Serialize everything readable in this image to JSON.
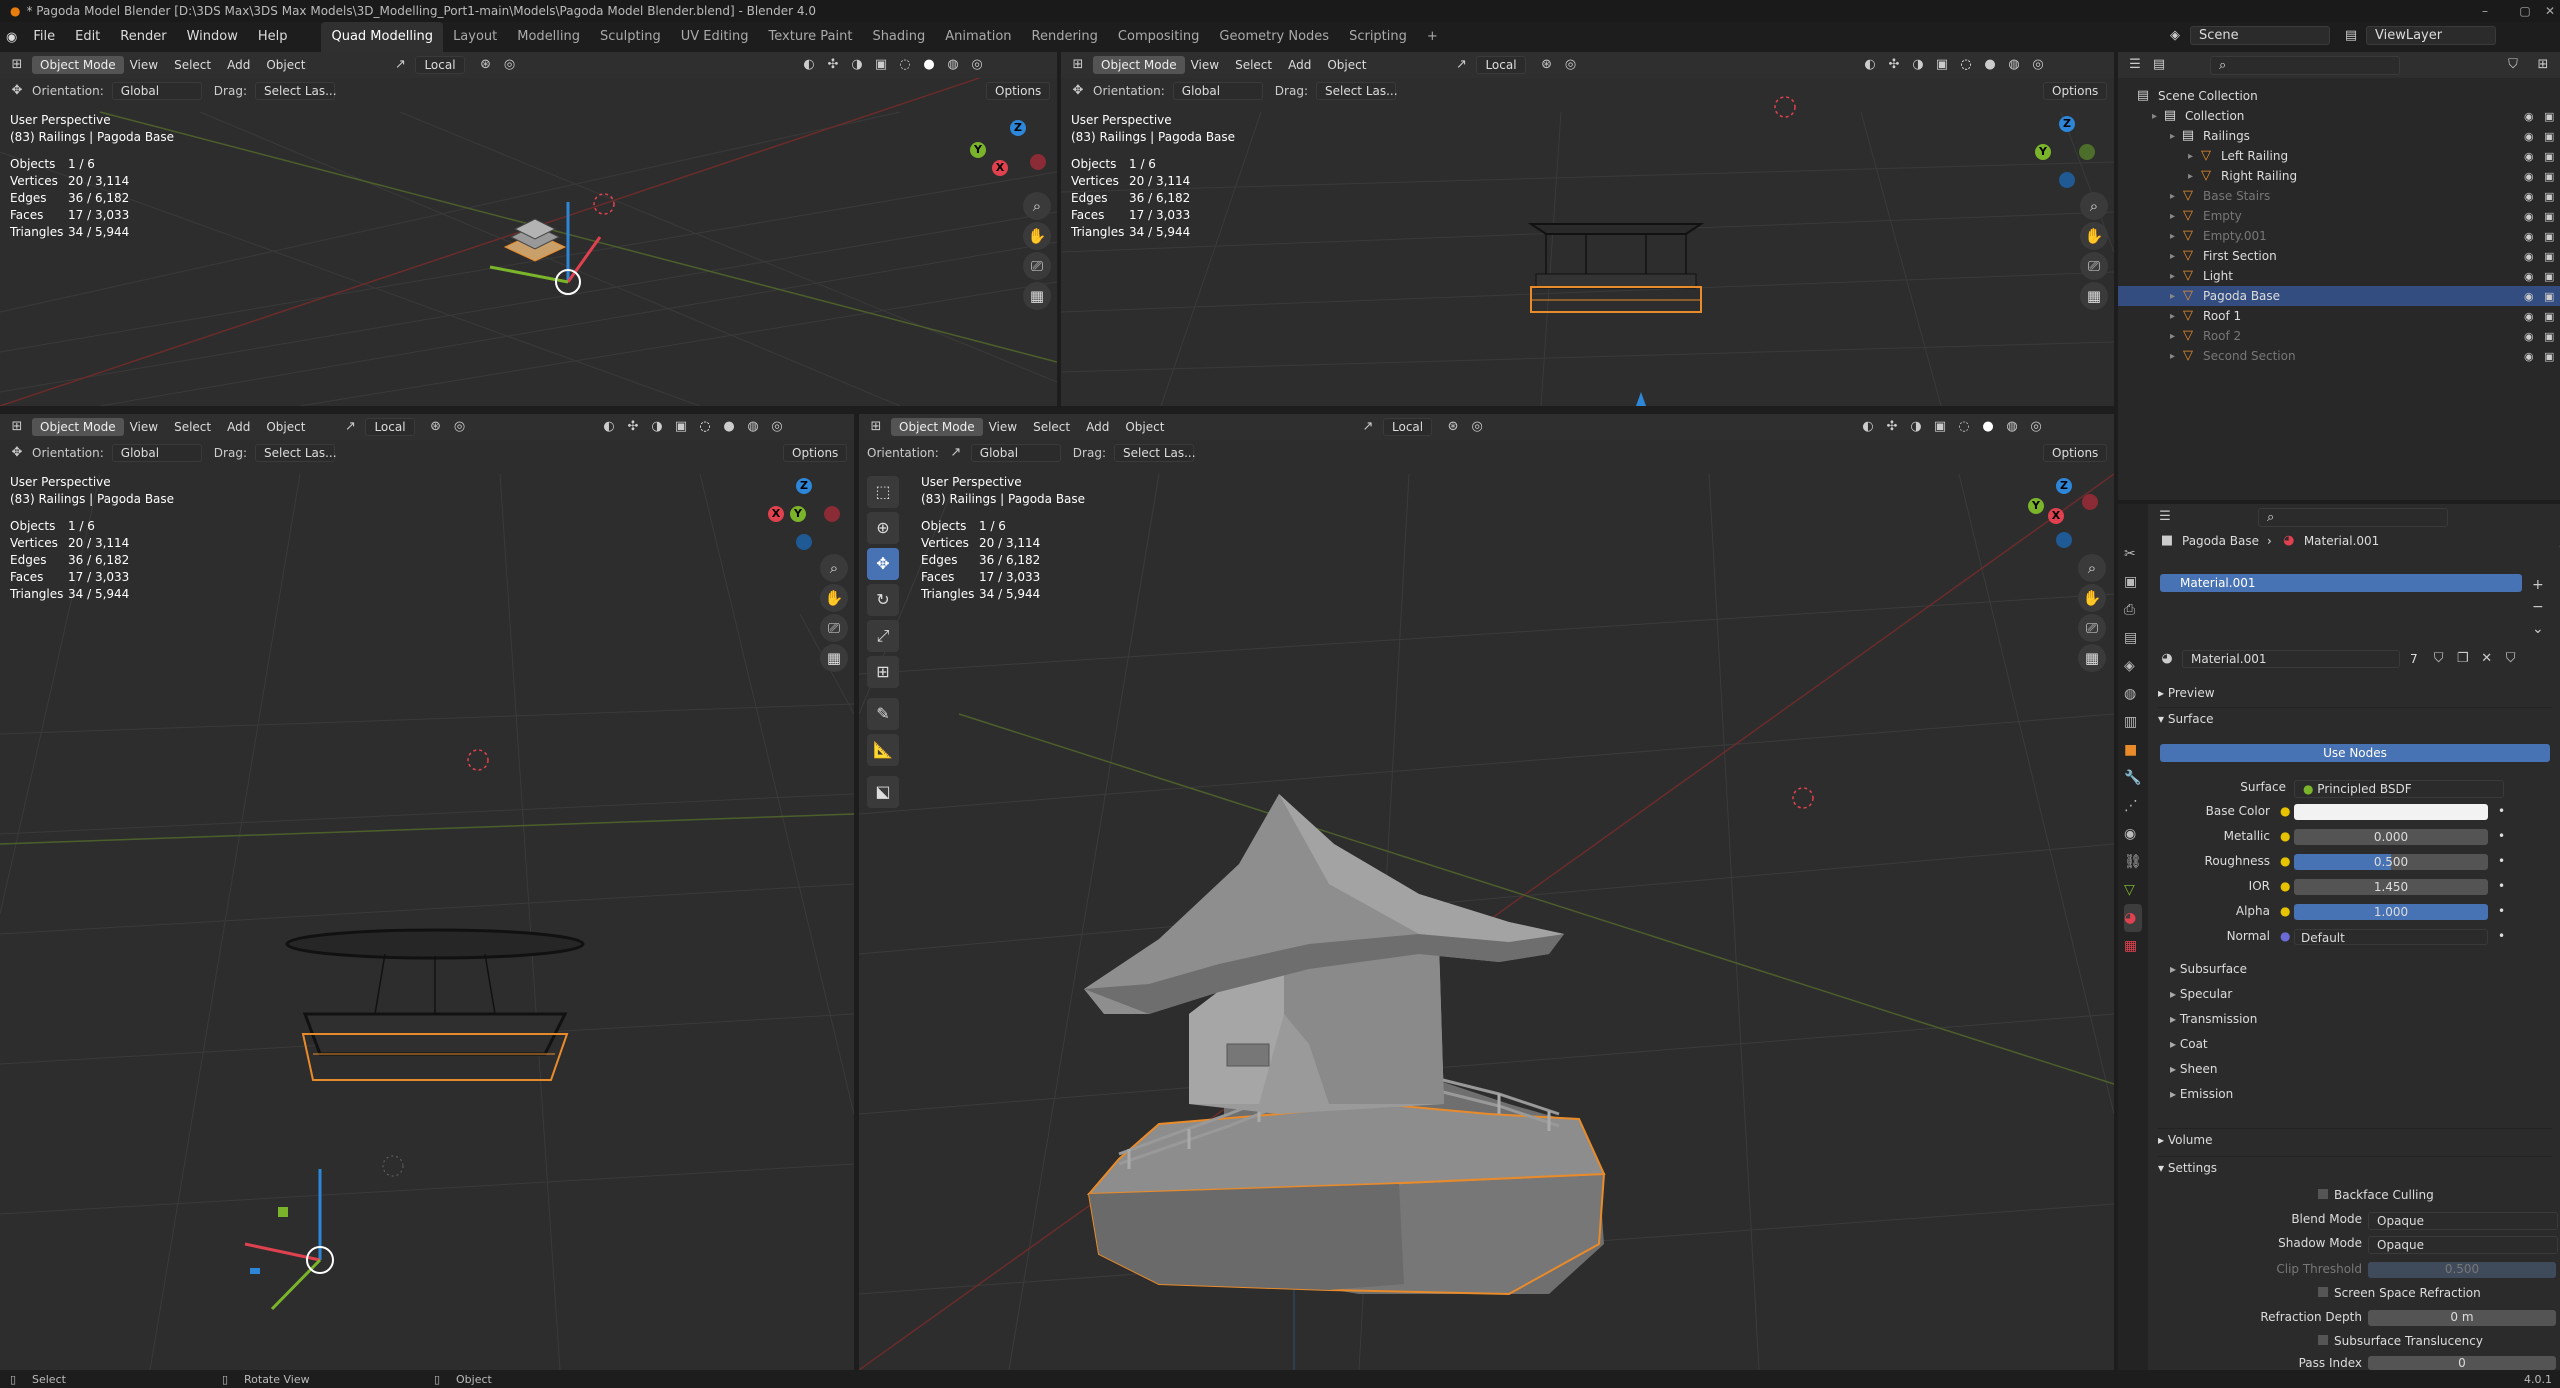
{
  "window": {
    "title": "* Pagoda Model Blender [D:\\3DS Max\\3DS Max Models\\3D_Modelling_Port1-main\\Models\\Pagoda Model Blender.blend] - Blender 4.0"
  },
  "menu": [
    "File",
    "Edit",
    "Render",
    "Window",
    "Help"
  ],
  "workspaces": [
    "Quad Modelling",
    "Layout",
    "Modelling",
    "Sculpting",
    "UV Editing",
    "Texture Paint",
    "Shading",
    "Animation",
    "Rendering",
    "Compositing",
    "Geometry Nodes",
    "Scripting",
    "+"
  ],
  "scene": {
    "name": "Scene",
    "view_layer": "ViewLayer"
  },
  "viewport": {
    "mode": "Object Mode",
    "view": "View",
    "select": "Select",
    "add": "Add",
    "object": "Object",
    "transform": "Local",
    "orientation_label": "Orientation:",
    "orientation": "Global",
    "drag_label": "Drag:",
    "drag": "Select Las...",
    "options": "Options",
    "perspective": "User Perspective",
    "context": "(83) Railings | Pagoda Base",
    "stats": [
      {
        "k": "Objects",
        "v": "1 / 6"
      },
      {
        "k": "Vertices",
        "v": "20 / 3,114"
      },
      {
        "k": "Edges",
        "v": "36 / 6,182"
      },
      {
        "k": "Faces",
        "v": "17 / 3,033"
      },
      {
        "k": "Triangles",
        "v": "34 / 5,944"
      }
    ],
    "axes": {
      "x": "X",
      "y": "Y",
      "z": "Z"
    }
  },
  "outliner": {
    "root": "Scene Collection",
    "items": [
      {
        "name": "Collection",
        "level": 1,
        "dim": false
      },
      {
        "name": "Railings",
        "level": 2,
        "dim": false
      },
      {
        "name": "Left Railing",
        "level": 3,
        "dim": false
      },
      {
        "name": "Right Railing",
        "level": 3,
        "dim": false
      },
      {
        "name": "Base Stairs",
        "level": 2,
        "dim": true
      },
      {
        "name": "Empty",
        "level": 2,
        "dim": true
      },
      {
        "name": "Empty.001",
        "level": 2,
        "dim": true
      },
      {
        "name": "First Section",
        "level": 2,
        "dim": false
      },
      {
        "name": "Light",
        "level": 2,
        "dim": false
      },
      {
        "name": "Pagoda Base",
        "level": 2,
        "dim": false,
        "selected": true
      },
      {
        "name": "Roof 1",
        "level": 2,
        "dim": false
      },
      {
        "name": "Roof 2",
        "level": 2,
        "dim": true
      },
      {
        "name": "Second Section",
        "level": 2,
        "dim": true
      }
    ]
  },
  "properties": {
    "breadcrumb_object": "Pagoda Base",
    "breadcrumb_material": "Material.001",
    "slot": "Material.001",
    "material": "Material.001",
    "users": "7",
    "panels": {
      "preview": "Preview",
      "surface": "Surface",
      "use_nodes": "Use Nodes"
    },
    "surface_label": "Surface",
    "surface_value": "Principled BSDF",
    "fields": [
      {
        "label": "Base Color",
        "value": "",
        "kind": "color"
      },
      {
        "label": "Metallic",
        "value": "0.000",
        "kind": "num",
        "fill": 0
      },
      {
        "label": "Roughness",
        "value": "0.500",
        "kind": "num",
        "fill": 0.5
      },
      {
        "label": "IOR",
        "value": "1.450",
        "kind": "num",
        "fill": 0
      },
      {
        "label": "Alpha",
        "value": "1.000",
        "kind": "num",
        "fill": 1
      },
      {
        "label": "Normal",
        "value": "Default",
        "kind": "link"
      }
    ],
    "subpanels": [
      "Subsurface",
      "Specular",
      "Transmission",
      "Coat",
      "Sheen",
      "Emission"
    ],
    "volume": "Volume",
    "settings": "Settings",
    "backface": "Backface Culling",
    "blend_mode_label": "Blend Mode",
    "blend_mode": "Opaque",
    "shadow_mode_label": "Shadow Mode",
    "shadow_mode": "Opaque",
    "clip_label": "Clip Threshold",
    "clip": "0.500",
    "ssr": "Screen Space Refraction",
    "refraction_label": "Refraction Depth",
    "refraction": "0 m",
    "sst": "Subsurface Translucency",
    "pass_label": "Pass Index",
    "pass": "0"
  },
  "status": {
    "select": "Select",
    "rotate": "Rotate View",
    "object": "Object",
    "version": "4.0.1"
  },
  "colors": {
    "selected": "#e98b2a",
    "accent": "#4772b3",
    "x": "#e0414f",
    "y": "#7ab42a",
    "z": "#2d86d8"
  }
}
